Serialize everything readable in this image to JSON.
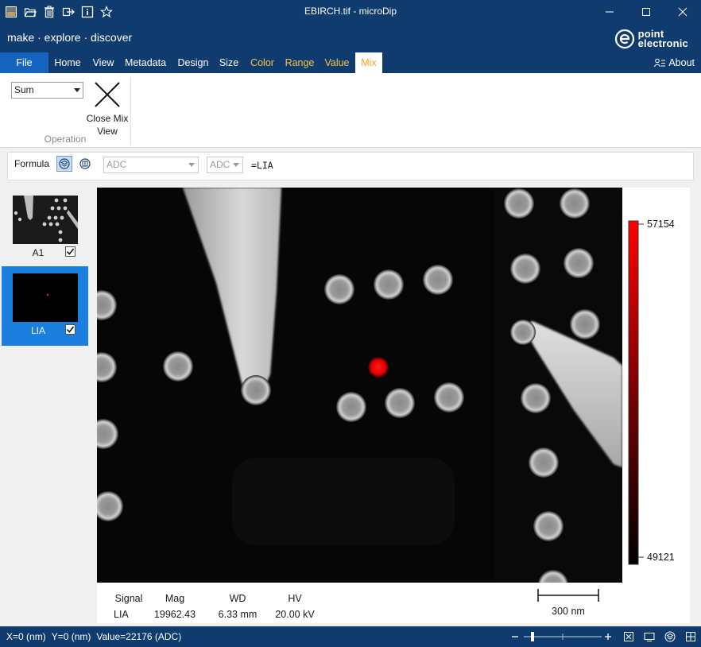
{
  "window": {
    "title": "EBIRCH.tif - microDip",
    "quick_access": [
      "image-icon",
      "folder-open-icon",
      "trash-icon",
      "export-icon",
      "info-icon",
      "star-icon"
    ]
  },
  "brand": {
    "tagline": "make · explore · discover",
    "logo_line1": "point",
    "logo_line2": "electronic"
  },
  "tabs": {
    "file": "File",
    "items": [
      "Home",
      "View",
      "Metadata",
      "Design",
      "Size"
    ],
    "context": [
      "Color",
      "Range",
      "Value"
    ],
    "active": "Mix",
    "about": "About"
  },
  "ribbon": {
    "operation_value": "Sum",
    "close_mix_label": "Close Mix View",
    "group_label": "Operation"
  },
  "formula": {
    "label": "Formula",
    "left_select": "ADC",
    "right_select": "ADC",
    "expression": "=LIA"
  },
  "thumbnails": [
    {
      "name": "A1",
      "checked": true,
      "selected": false
    },
    {
      "name": "LIA",
      "checked": true,
      "selected": true
    }
  ],
  "colorbar": {
    "max": "57154",
    "min": "49121"
  },
  "info": {
    "signal_label": "Signal",
    "signal_value": "LIA",
    "mag_label": "Mag",
    "mag_value": "19962.43",
    "wd_label": "WD",
    "wd_value": "6.33 mm",
    "hv_label": "HV",
    "hv_value": "20.00 kV",
    "scale_label": "300 nm"
  },
  "status": {
    "x": "X=0 (nm)",
    "y": "Y=0 (nm)",
    "value": "Value=22176 (ADC)"
  },
  "colors": {
    "brand_blue": "#0f3b6e",
    "file_blue": "#1565c0",
    "context_tab": "#f5c542",
    "active_tab_text": "#f5a623",
    "selected_thumb": "#1b7fe0"
  }
}
